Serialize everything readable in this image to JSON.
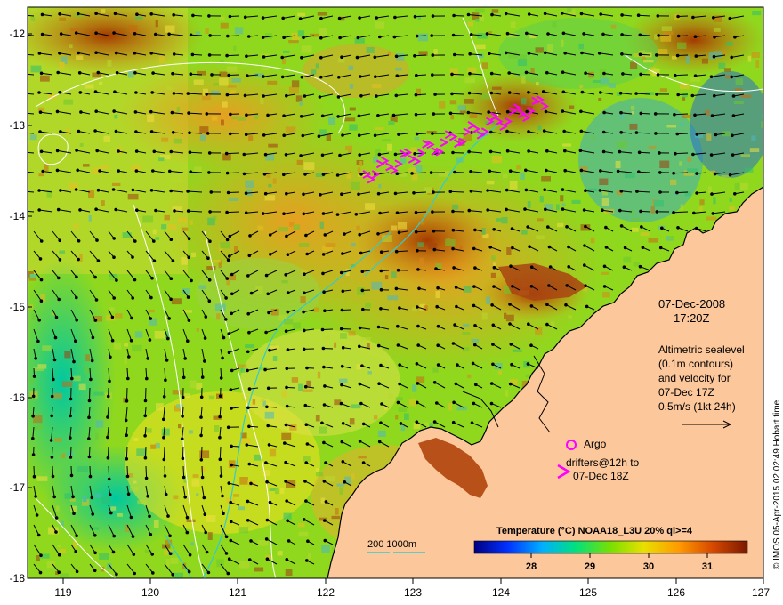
{
  "date": "07-Dec-2008",
  "time": "17:20Z",
  "altimetry_text": [
    "Altimetric sealevel",
    "(0.1m contours)",
    "and velocity for",
    "07-Dec 17Z",
    "0.5m/s (1kt 24h)"
  ],
  "argo_label": "Argo",
  "drifters_label": [
    "drifters@12h to",
    "07-Dec 18Z"
  ],
  "bathymetry_label": "200  1000m",
  "colorbar": {
    "title": "Temperature (°C) NOAA18_L3U 20% ql>=4",
    "ticks": [
      "28",
      "29",
      "30",
      "31"
    ]
  },
  "side_credit": "© IMOS 05-Apr-2015 02:02:49 Hobart time",
  "axes": {
    "lat_ticks": [
      "-12",
      "-13",
      "-14",
      "-15",
      "-16",
      "-17",
      "-18"
    ],
    "lon_ticks": [
      "119",
      "120",
      "121",
      "122",
      "123",
      "124",
      "125",
      "126",
      "127"
    ]
  },
  "colors": {
    "land": "#fcc79a",
    "drifter": "#ff00ff",
    "bathymetry_line": "#33cccc",
    "contour": "#ffffff"
  }
}
